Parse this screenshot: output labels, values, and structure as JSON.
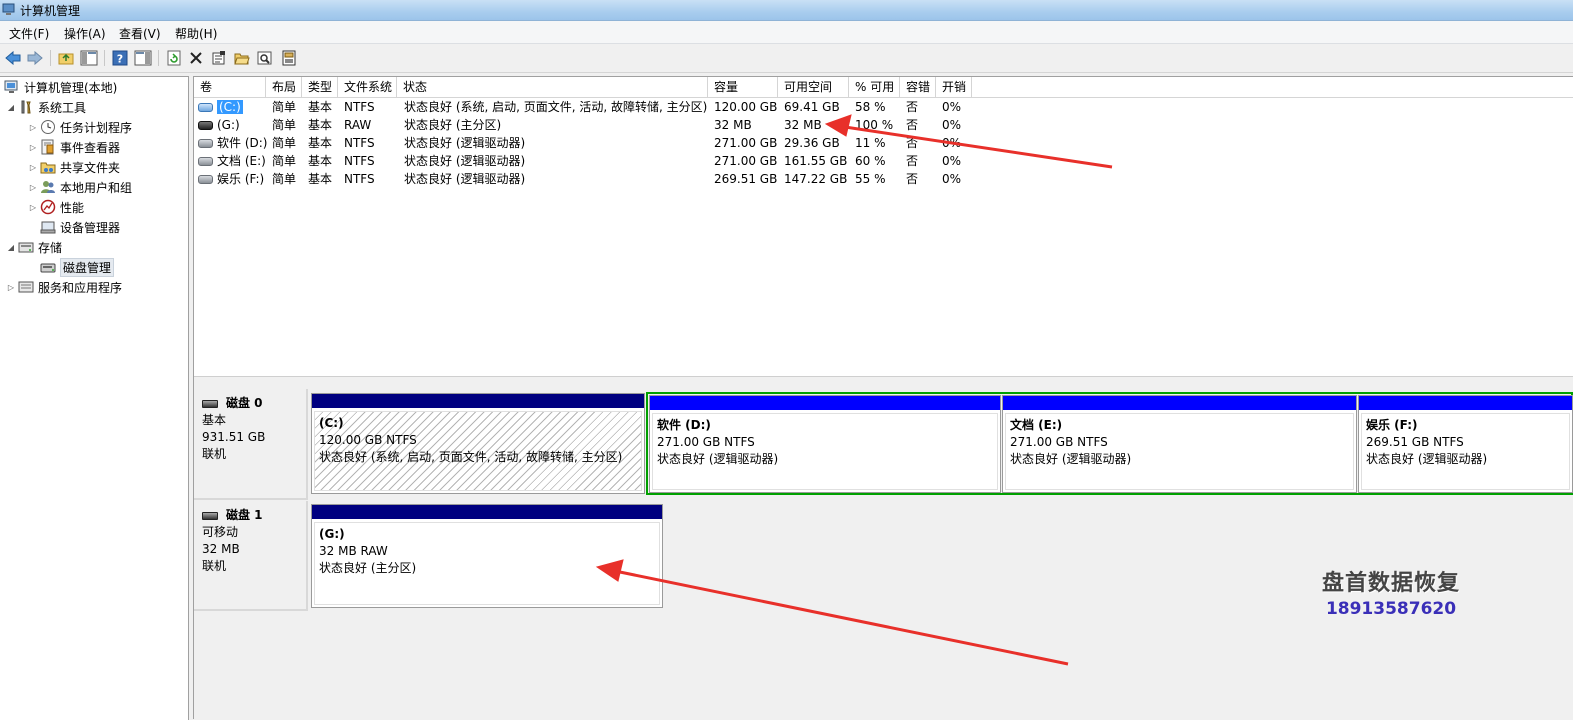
{
  "window": {
    "title": "计算机管理"
  },
  "menu": [
    "文件(F)",
    "操作(A)",
    "查看(V)",
    "帮助(H)"
  ],
  "toolbar": {
    "icons": [
      "back-icon",
      "forward-icon",
      "up-folder-icon",
      "show-hide-tree-icon",
      "help-icon",
      "show-hide-action-icon",
      "refresh-icon",
      "delete-icon",
      "properties-icon",
      "open-icon",
      "search-icon",
      "export-icon"
    ]
  },
  "tree": {
    "root": "计算机管理(本地)",
    "system_tools": "系统工具",
    "task_scheduler": "任务计划程序",
    "event_viewer": "事件查看器",
    "shared_folders": "共享文件夹",
    "local_users": "本地用户和组",
    "performance": "性能",
    "device_manager": "设备管理器",
    "storage": "存储",
    "disk_management": "磁盘管理",
    "services_apps": "服务和应用程序"
  },
  "volumes": {
    "columns": [
      "卷",
      "布局",
      "类型",
      "文件系统",
      "状态",
      "容量",
      "可用空间",
      "% 可用",
      "容错",
      "开销"
    ],
    "rows": [
      {
        "vol": "(C:)",
        "layout": "简单",
        "type": "基本",
        "fs": "NTFS",
        "status": "状态良好 (系统, 启动, 页面文件, 活动, 故障转储, 主分区)",
        "capacity": "120.00 GB",
        "free": "69.41 GB",
        "pct": "58 %",
        "ft": "否",
        "overhead": "0%"
      },
      {
        "vol": "(G:)",
        "layout": "简单",
        "type": "基本",
        "fs": "RAW",
        "status": "状态良好 (主分区)",
        "capacity": "32 MB",
        "free": "32 MB",
        "pct": "100 %",
        "ft": "否",
        "overhead": "0%"
      },
      {
        "vol": "软件 (D:)",
        "layout": "简单",
        "type": "基本",
        "fs": "NTFS",
        "status": "状态良好 (逻辑驱动器)",
        "capacity": "271.00 GB",
        "free": "29.36 GB",
        "pct": "11 %",
        "ft": "否",
        "overhead": "0%"
      },
      {
        "vol": "文档 (E:)",
        "layout": "简单",
        "type": "基本",
        "fs": "NTFS",
        "status": "状态良好 (逻辑驱动器)",
        "capacity": "271.00 GB",
        "free": "161.55 GB",
        "pct": "60 %",
        "ft": "否",
        "overhead": "0%"
      },
      {
        "vol": "娱乐 (F:)",
        "layout": "简单",
        "type": "基本",
        "fs": "NTFS",
        "status": "状态良好 (逻辑驱动器)",
        "capacity": "269.51 GB",
        "free": "147.22 GB",
        "pct": "55 %",
        "ft": "否",
        "overhead": "0%"
      }
    ]
  },
  "disks": [
    {
      "name": "磁盘 0",
      "type": "基本",
      "size": "931.51 GB",
      "state": "联机",
      "partitions": [
        {
          "name": "(C:)",
          "size": "120.00 GB NTFS",
          "status": "状态良好 (系统, 启动, 页面文件, 活动, 故障转储, 主分区)"
        },
        {
          "name": "软件  (D:)",
          "size": "271.00 GB NTFS",
          "status": "状态良好 (逻辑驱动器)"
        },
        {
          "name": "文档  (E:)",
          "size": "271.00 GB NTFS",
          "status": "状态良好 (逻辑驱动器)"
        },
        {
          "name": "娱乐  (F:)",
          "size": "269.51 GB NTFS",
          "status": "状态良好 (逻辑驱动器)"
        }
      ]
    },
    {
      "name": "磁盘 1",
      "type": "可移动",
      "size": "32 MB",
      "state": "联机",
      "partitions": [
        {
          "name": "(G:)",
          "size": "32 MB RAW",
          "status": "状态良好 (主分区)"
        }
      ]
    }
  ],
  "watermark": {
    "line1": "盘首数据恢复",
    "line2": "18913587620"
  },
  "colors": {
    "primary_bar": "#000080",
    "logical_bar": "#0000ff",
    "extended_frame": "#00a000",
    "arrow": "#e8302a"
  }
}
